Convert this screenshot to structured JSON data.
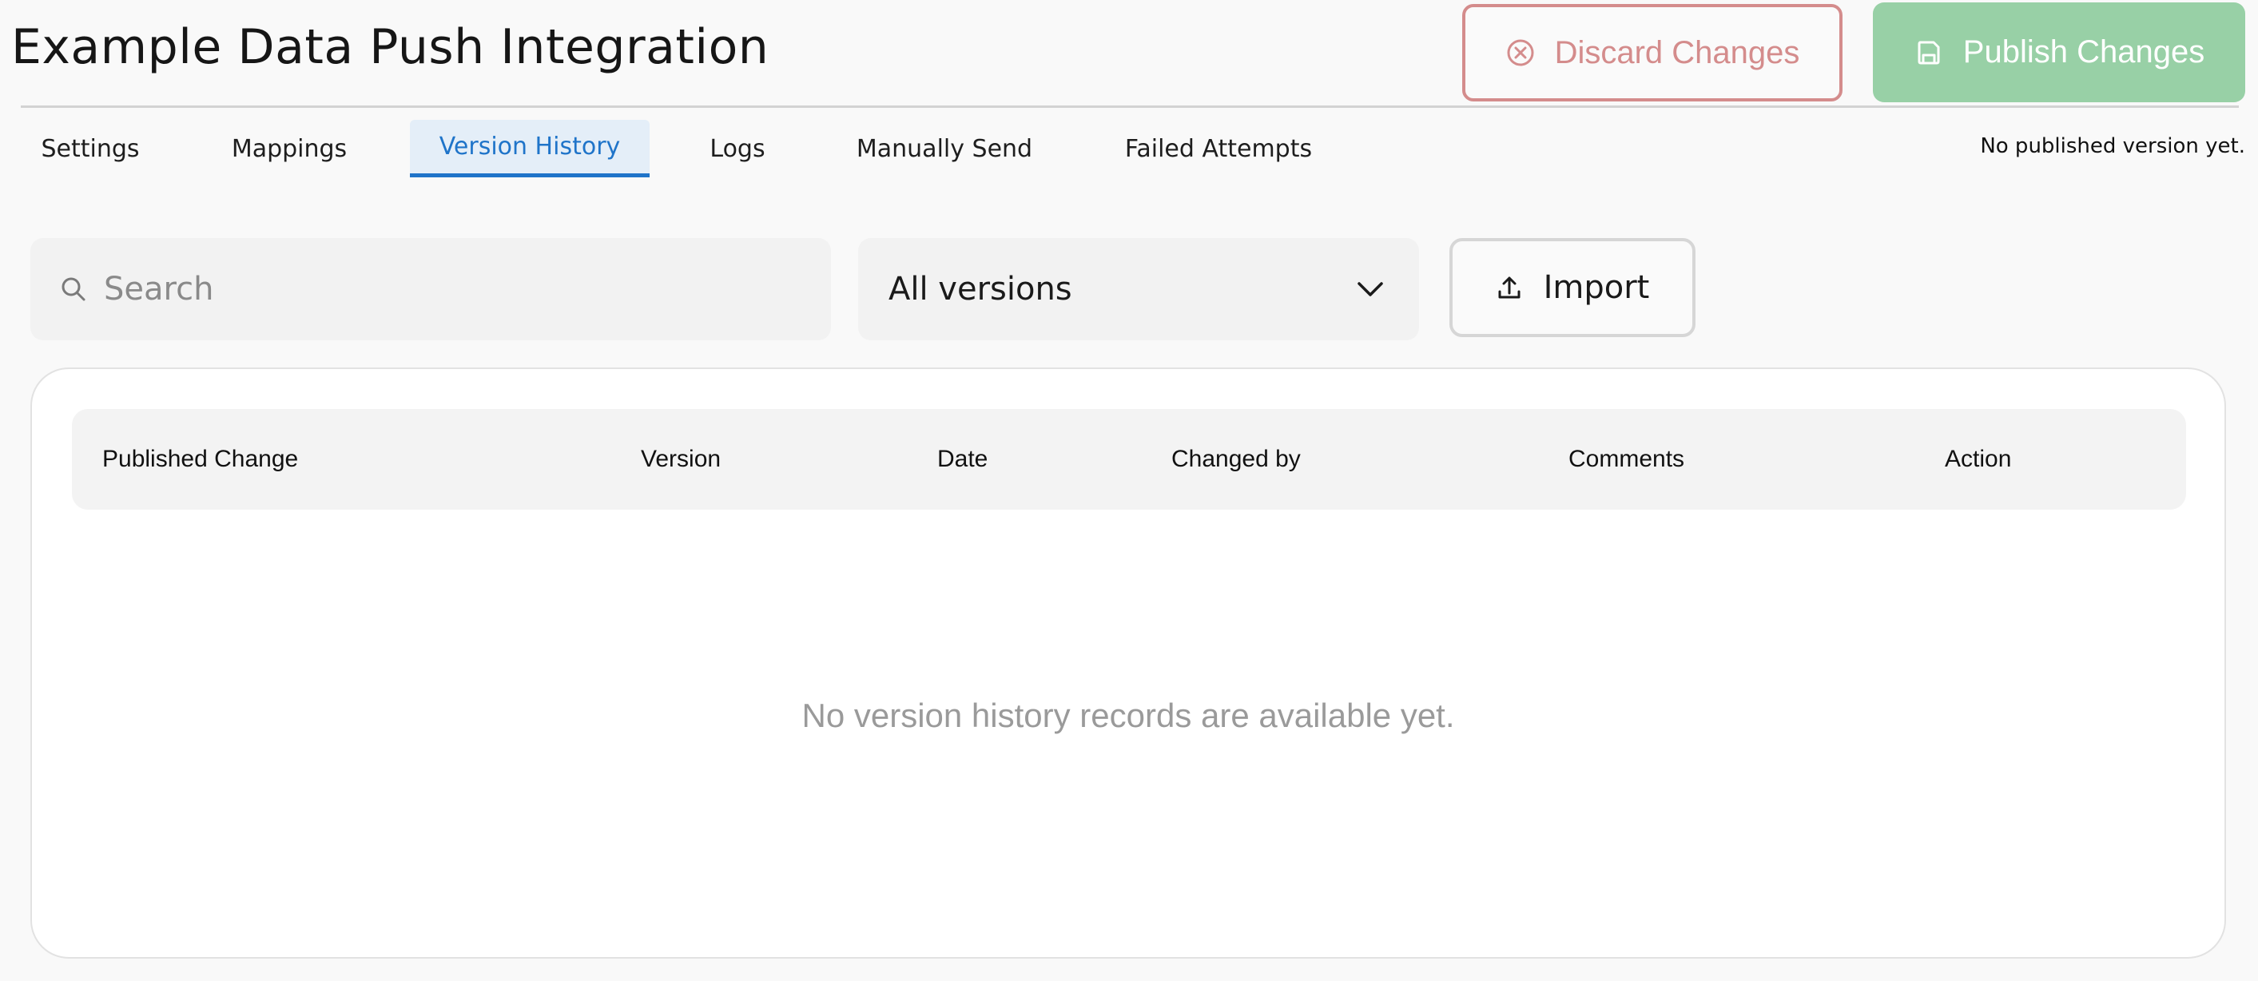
{
  "header": {
    "title": "Example Data Push Integration",
    "discard_label": "Discard Changes",
    "publish_label": "Publish Changes"
  },
  "tabs": [
    {
      "label": "Settings",
      "active": false
    },
    {
      "label": "Mappings",
      "active": false
    },
    {
      "label": "Version History",
      "active": true
    },
    {
      "label": "Logs",
      "active": false
    },
    {
      "label": "Manually Send",
      "active": false
    },
    {
      "label": "Failed Attempts",
      "active": false
    }
  ],
  "status_text": "No published version yet.",
  "toolbar": {
    "search": {
      "placeholder": "Search",
      "value": ""
    },
    "filter": {
      "selected": "All versions"
    },
    "import_label": "Import"
  },
  "table": {
    "columns": [
      "Published Change",
      "Version",
      "Date",
      "Changed by",
      "Comments",
      "Action"
    ],
    "rows": [],
    "empty_message": "No version history records are available yet."
  },
  "icons": {
    "discard": "close-circle-icon",
    "publish": "save-icon",
    "search": "search-icon",
    "dropdown": "chevron-down-icon",
    "import": "upload-icon"
  },
  "colors": {
    "discard": "#d48c8c",
    "publish": "#98d0a6",
    "active_tab": "#1f74c9",
    "active_tab_bg": "#e4eef8"
  }
}
